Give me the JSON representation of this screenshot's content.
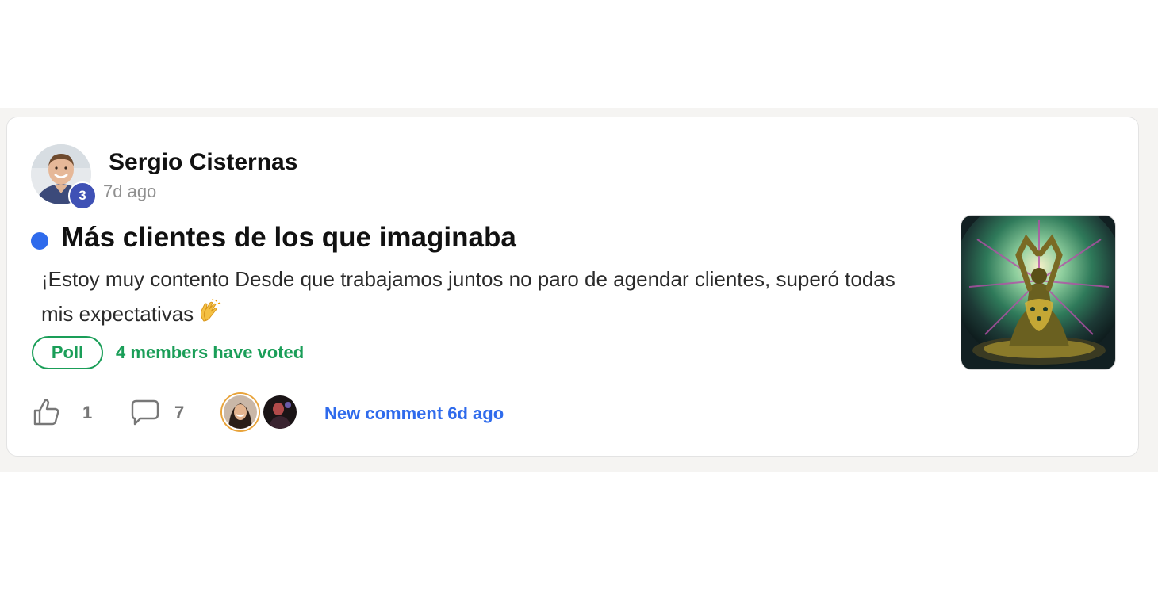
{
  "post": {
    "author": {
      "name": "Sergio Cisternas",
      "level": "3",
      "time_ago": "7d ago"
    },
    "title": "Más clientes de los que imaginaba",
    "body": "¡Estoy muy contento Desde que trabajamos juntos no paro de agendar clientes, superó todas mis expectativas",
    "body_emoji_icon": "clapping-hands-icon",
    "poll": {
      "label": "Poll",
      "votes_text": "4 members have voted"
    },
    "stats": {
      "likes": "1",
      "comments": "7"
    },
    "new_comment_text": "New comment 6d ago"
  },
  "colors": {
    "accent_blue": "#2f6bec",
    "poll_green": "#1a9e58",
    "level_badge": "#3f51b5"
  }
}
